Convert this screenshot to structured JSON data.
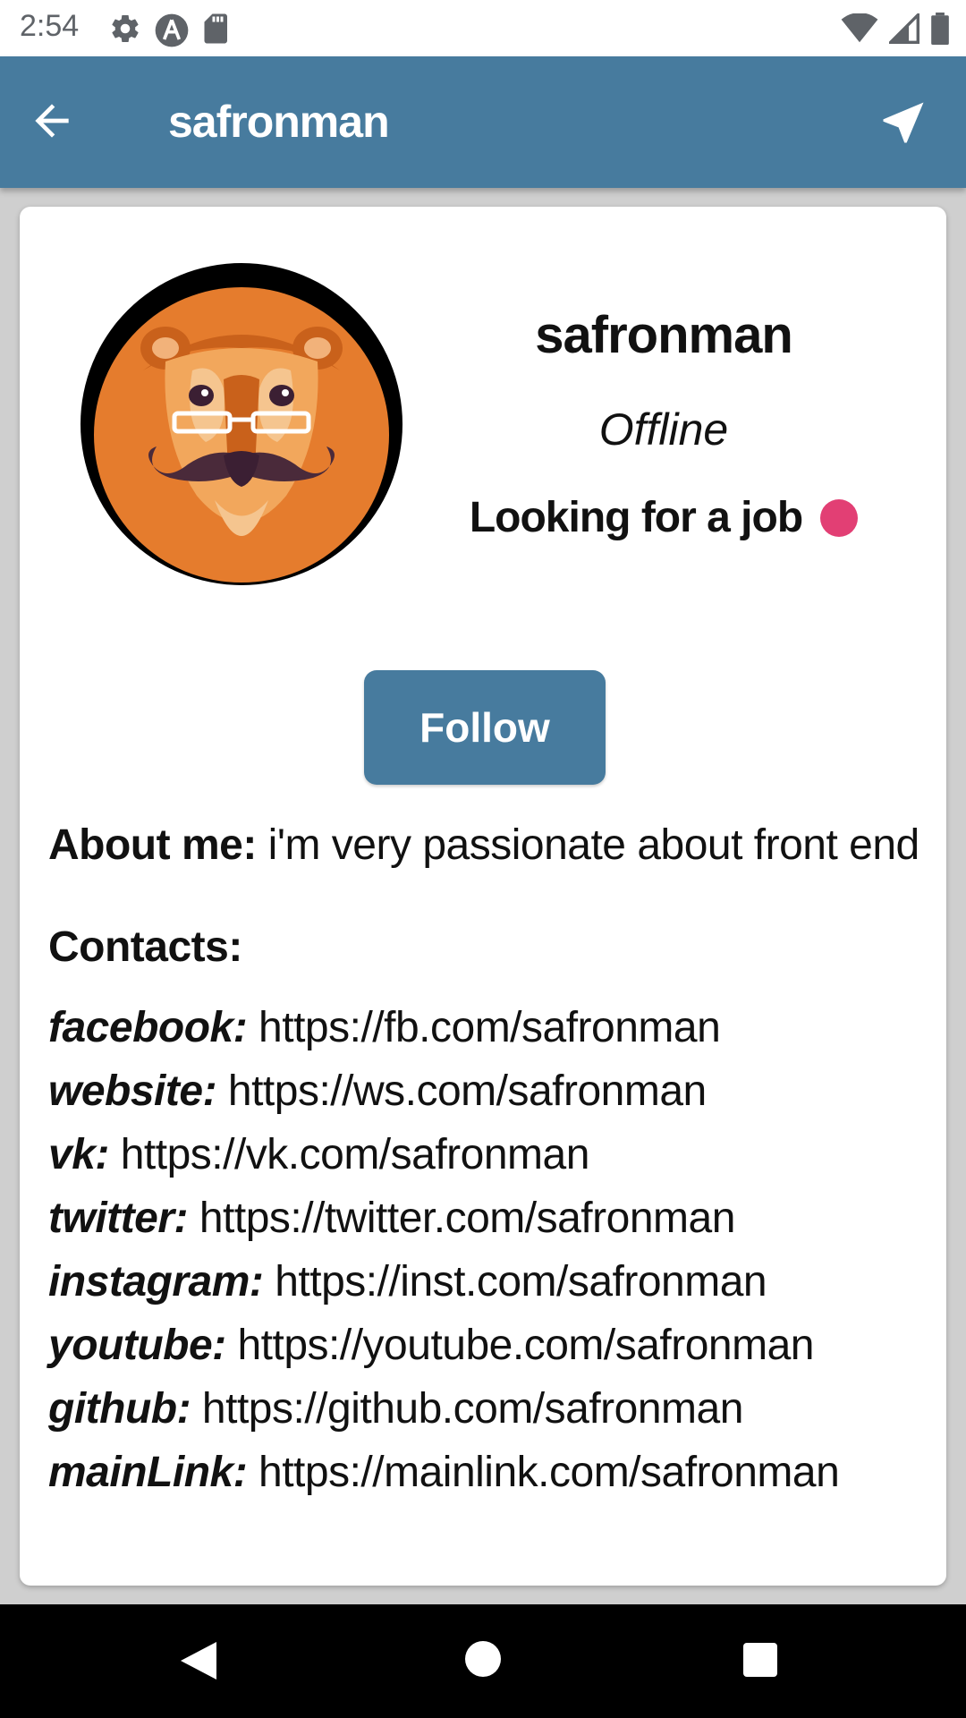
{
  "status_bar": {
    "time": "2:54",
    "left_icons": [
      "settings-icon",
      "a-logo-icon",
      "sd-card-icon"
    ],
    "right_icons": [
      "wifi-icon",
      "signal-icon",
      "battery-icon"
    ]
  },
  "app_bar": {
    "title": "safronman",
    "color": "#477b9e",
    "back_icon": "arrow-left-icon",
    "action_icon": "navigation-arrow-icon"
  },
  "profile": {
    "name": "safronman",
    "status": "Offline",
    "job_label": "Looking for a job",
    "job_indicator_color": "#e23f74",
    "avatar": "lion-mustache-avatar"
  },
  "follow_button": {
    "label": "Follow"
  },
  "about": {
    "label": "About me:",
    "text": " i'm very passionate about front end"
  },
  "contacts": {
    "title": "Contacts:",
    "items": [
      {
        "key": "facebook:",
        "value": " https://fb.com/safronman"
      },
      {
        "key": "website:",
        "value": " https://ws.com/safronman"
      },
      {
        "key": "vk:",
        "value": " https://vk.com/safronman"
      },
      {
        "key": "twitter:",
        "value": " https://twitter.com/safronman"
      },
      {
        "key": "instagram:",
        "value": " https://inst.com/safronman"
      },
      {
        "key": "youtube:",
        "value": " https://youtube.com/safronman"
      },
      {
        "key": "github:",
        "value": " https://github.com/safronman"
      },
      {
        "key": "mainLink:",
        "value": " https://mainlink.com/safronman"
      }
    ]
  },
  "nav_bar": {
    "buttons": [
      "back-triangle-icon",
      "home-circle-icon",
      "recents-square-icon"
    ]
  }
}
